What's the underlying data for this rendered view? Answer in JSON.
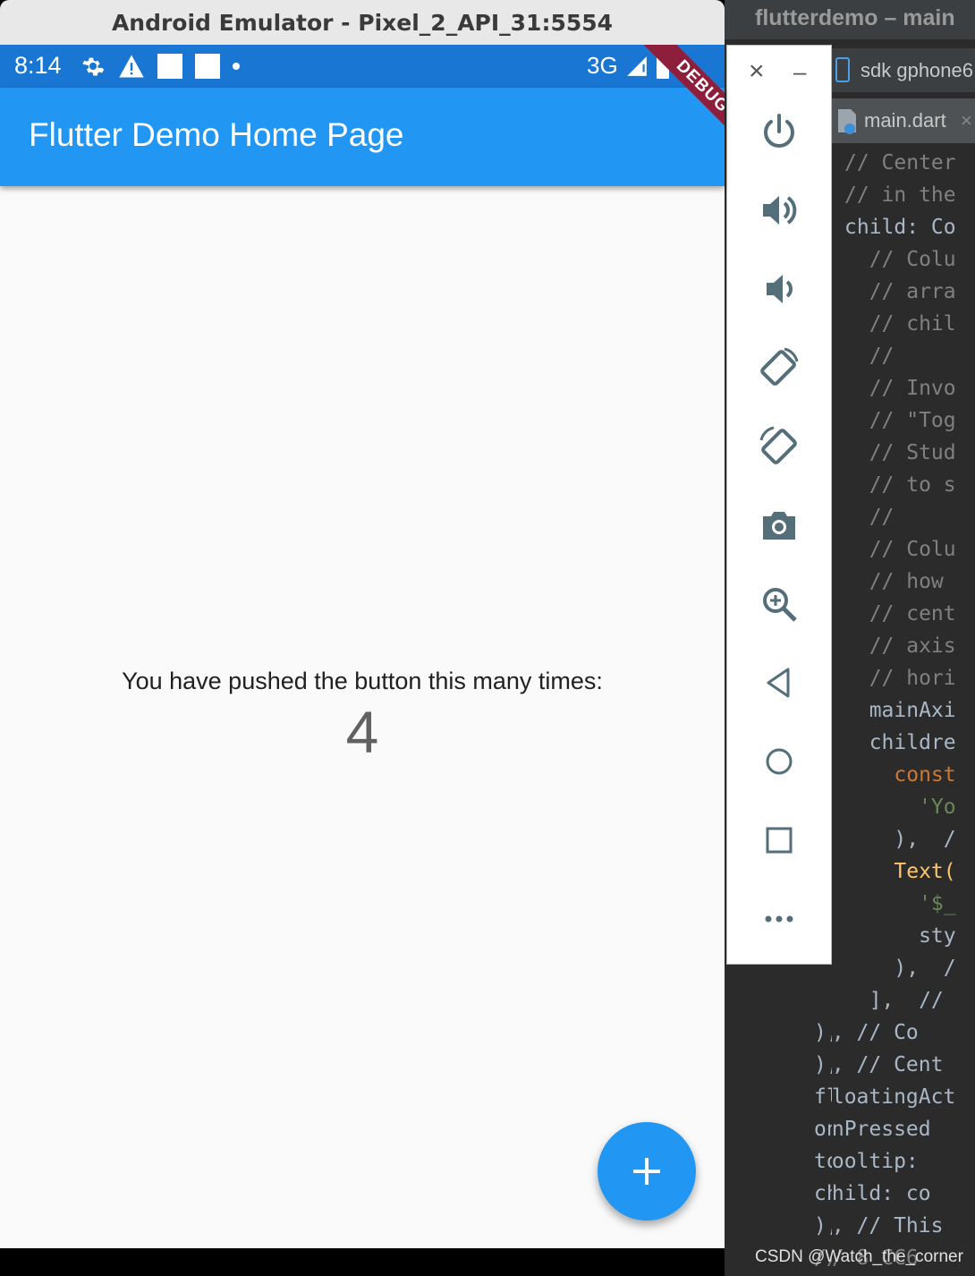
{
  "emulator": {
    "window_title": "Android Emulator - Pixel_2_API_31:5554",
    "status_bar": {
      "time": "8:14",
      "network": "3G"
    },
    "debug_banner": "DEBUG",
    "app_bar": {
      "title": "Flutter Demo Home Page"
    },
    "body": {
      "message": "You have pushed the button this many times:",
      "counter": "4"
    },
    "fab": {
      "icon": "plus-icon"
    }
  },
  "toolbar": {
    "window_controls": {
      "close": "×",
      "minimize": "–"
    },
    "buttons": [
      "power-icon",
      "volume-up-icon",
      "volume-down-icon",
      "rotate-left-icon",
      "rotate-right-icon",
      "camera-icon",
      "zoom-in-icon",
      "back-icon",
      "home-icon",
      "overview-icon",
      "more-icon"
    ]
  },
  "ide": {
    "title": "flutterdemo – main",
    "device_tab": "sdk gphone6",
    "file_tab": "main.dart",
    "code_lines": [
      "// Center",
      "// in the",
      "child: Co",
      "  // Colu",
      "  // arra",
      "  // chil",
      "  //",
      "  // Invo",
      "  // \"Tog",
      "  // Stud",
      "  // to s",
      "  //",
      "  // Colu",
      "  // how",
      "  // cent",
      "  // axis",
      "  // hori",
      "  mainAxi",
      "  childre",
      "    const",
      "      'Yo",
      "    ),  /",
      "    Text(",
      "      '$_",
      "      sty",
      "    ),  /",
      "  ],  //",
      "), // Co",
      "), // Cent",
      "floatingAct",
      "onPressed",
      "tooltip:",
      "child: co",
      "), // This",
      "// 8 CC6"
    ]
  },
  "watermark": "CSDN @Watch_the_corner"
}
